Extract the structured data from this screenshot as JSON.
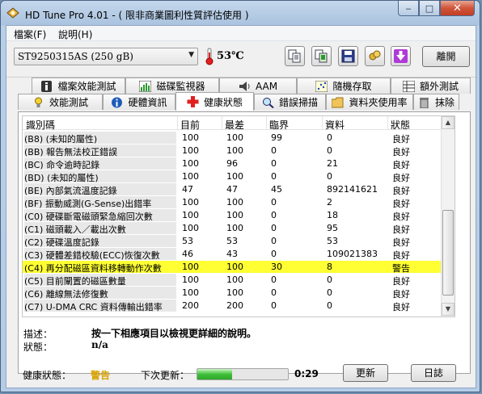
{
  "window": {
    "title": "HD Tune Pro 4.01 - ( 限非商業圖利性質評估使用 )",
    "minimize_glyph": "‒",
    "maximize_glyph": "□",
    "close_glyph": "✕"
  },
  "menu": {
    "items": [
      "檔案(F)",
      "說明(H)"
    ]
  },
  "toolbar": {
    "drive": "ST9250315AS (250 gB)",
    "temperature": "53℃",
    "icons": [
      "copy-text-icon",
      "copy-screenshot-icon",
      "save-icon",
      "options-icon",
      "download-icon"
    ],
    "exit_label": "離開"
  },
  "tabs": {
    "row1": [
      "檔案效能測試",
      "磁碟監視器",
      "AAM",
      "隨機存取",
      "額外測試"
    ],
    "row2": [
      "效能測試",
      "硬體資訊",
      "健康狀態",
      "錯誤掃描",
      "資料夾使用率",
      "抹除"
    ],
    "active": "健康狀態"
  },
  "smart": {
    "headers": [
      "識別碼",
      "目前",
      "最差",
      "臨界",
      "資料",
      "狀態"
    ],
    "rows": [
      [
        "(B8) (未知的屬性)",
        "100",
        "100",
        "99",
        "0",
        "良好"
      ],
      [
        "(BB) 報告無法校正錯誤",
        "100",
        "100",
        "0",
        "0",
        "良好"
      ],
      [
        "(BC) 命令逾時記錄",
        "100",
        "96",
        "0",
        "21",
        "良好"
      ],
      [
        "(BD) (未知的屬性)",
        "100",
        "100",
        "0",
        "0",
        "良好"
      ],
      [
        "(BE) 內部氣流溫度記錄",
        "47",
        "47",
        "45",
        "892141621",
        "良好"
      ],
      [
        "(BF) 振動威測(G-Sense)出錯率",
        "100",
        "100",
        "0",
        "2",
        "良好"
      ],
      [
        "(C0) 硬碟斷電磁頭緊急縮回次數",
        "100",
        "100",
        "0",
        "18",
        "良好"
      ],
      [
        "(C1) 磁頭載入／載出次數",
        "100",
        "100",
        "0",
        "95",
        "良好"
      ],
      [
        "(C2) 硬碟溫度記錄",
        "53",
        "53",
        "0",
        "53",
        "良好"
      ],
      [
        "(C3) 硬體差錯校驗(ECC)恢復次數",
        "46",
        "43",
        "0",
        "109021383",
        "良好"
      ],
      [
        "(C4) 再分配磁區資料移轉動作次數",
        "100",
        "100",
        "30",
        "8",
        "警告"
      ],
      [
        "(C5) 目前闡置的磁區數量",
        "100",
        "100",
        "0",
        "0",
        "良好"
      ],
      [
        "(C6) 離線無法修復數",
        "100",
        "100",
        "0",
        "0",
        "良好"
      ],
      [
        "(C7) U-DMA CRC 資料傳輸出錯率",
        "200",
        "200",
        "0",
        "0",
        "良好"
      ]
    ],
    "highlight_row": 10
  },
  "description": {
    "label": "描述：",
    "text": "按一下相應項目以檢視更詳細的說明。",
    "status_label": "狀態：",
    "status_value": "n/a"
  },
  "statusbar": {
    "health_label": "健康狀態：",
    "health_value": "警告",
    "health_color": "#d9a300",
    "next_update_label": "下次更新：",
    "progress_fraction": 0.38,
    "countdown": "0:29",
    "update_label": "更新",
    "log_label": "日誌"
  }
}
